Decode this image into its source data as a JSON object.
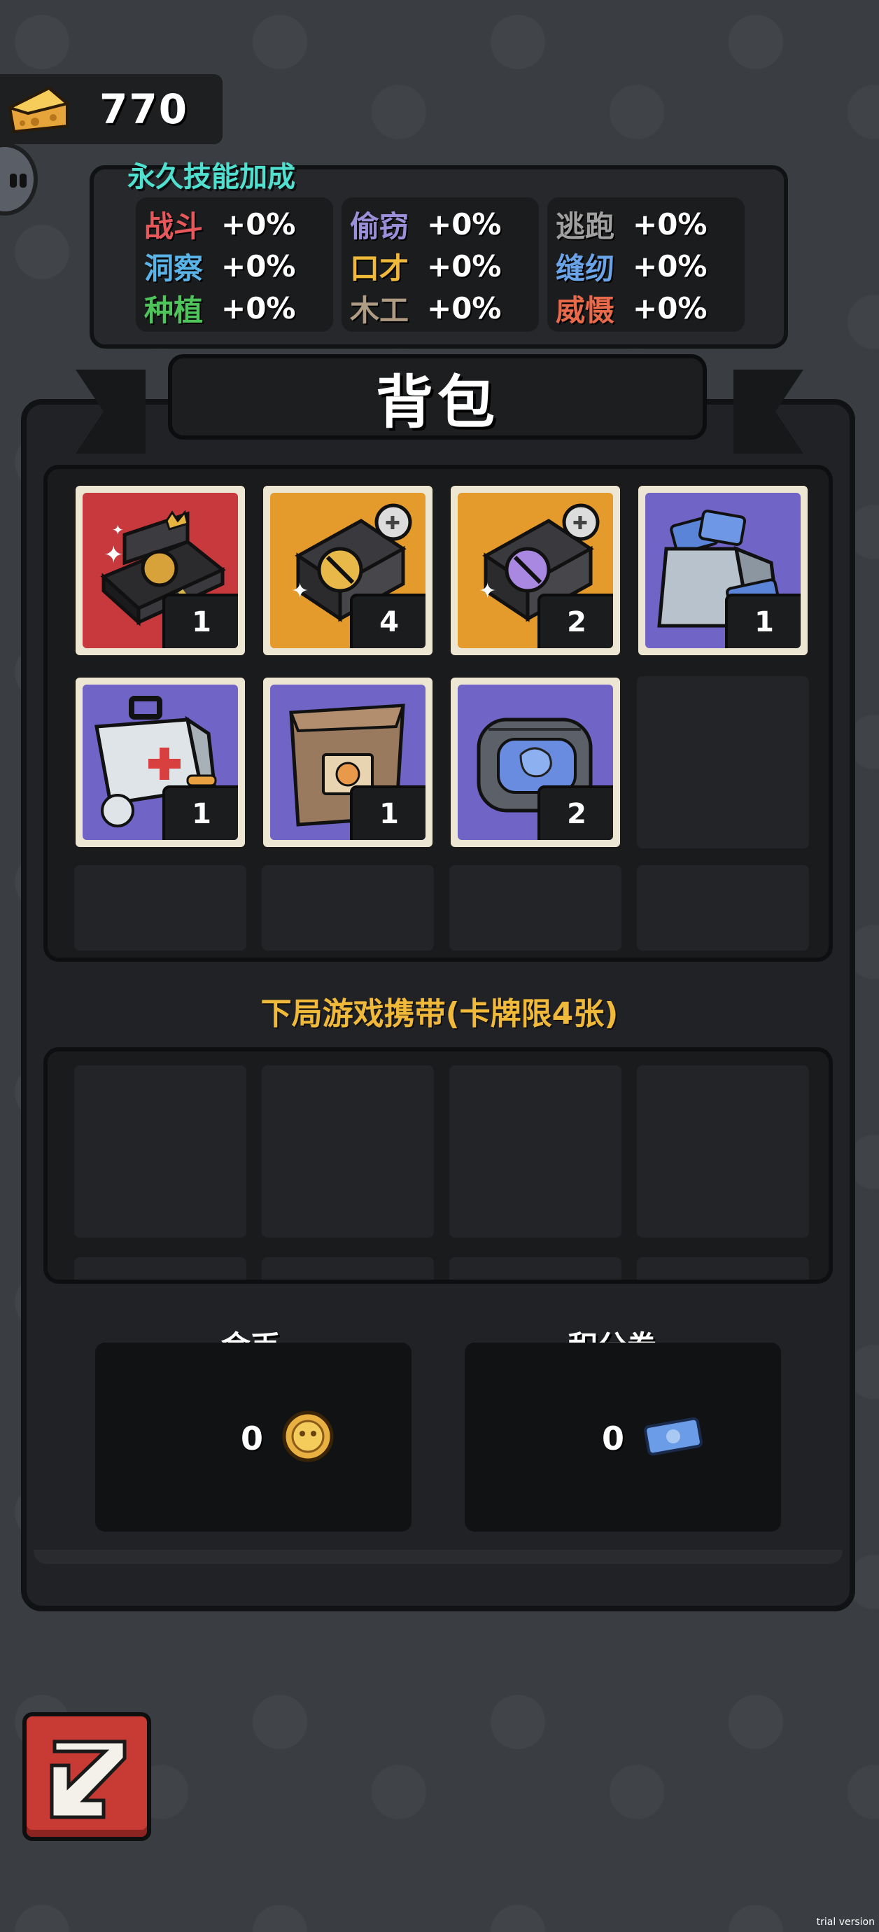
{
  "cheese": {
    "value": "770",
    "icon": "cheese-icon"
  },
  "skills": {
    "title": "永久技能加成",
    "groups": [
      [
        {
          "name": "战斗",
          "value": "+0%",
          "color": "#e8585a"
        },
        {
          "name": "洞察",
          "value": "+0%",
          "color": "#5ab4e8"
        },
        {
          "name": "种植",
          "value": "+0%",
          "color": "#4ec45a"
        }
      ],
      [
        {
          "name": "偷窃",
          "value": "+0%",
          "color": "#9a8fd8"
        },
        {
          "name": "口才",
          "value": "+0%",
          "color": "#f0b93a"
        },
        {
          "name": "木工",
          "value": "+0%",
          "color": "#b09c84"
        }
      ],
      [
        {
          "name": "逃跑",
          "value": "+0%",
          "color": "#a0a0a0"
        },
        {
          "name": "缝纫",
          "value": "+0%",
          "color": "#6aa4e8"
        },
        {
          "name": "威慑",
          "value": "+0%",
          "color": "#e86a4a"
        }
      ]
    ]
  },
  "backpack": {
    "title": "背包",
    "items": [
      {
        "icon": "gift-box-icon",
        "count": "1",
        "bg": "#c8393e"
      },
      {
        "icon": "golden-chest-icon",
        "count": "4",
        "bg": "#e59a2c"
      },
      {
        "icon": "purple-chest-icon",
        "count": "2",
        "bg": "#e59a2c"
      },
      {
        "icon": "ticket-bag-icon",
        "count": "1",
        "bg": "#7065c6"
      },
      {
        "icon": "first-aid-kit-icon",
        "count": "1",
        "bg": "#7065c6"
      },
      {
        "icon": "cloth-sack-icon",
        "count": "1",
        "bg": "#7065c6"
      },
      {
        "icon": "pouch-icon",
        "count": "2",
        "bg": "#7065c6"
      }
    ]
  },
  "carry": {
    "label": "下局游戏携带(卡牌限4张)"
  },
  "currency": {
    "gold": {
      "label": "金币",
      "value": "0",
      "icon": "gold-coin-icon"
    },
    "points": {
      "label": "积分券",
      "value": "0",
      "icon": "point-ticket-icon"
    }
  },
  "back_button": {
    "icon": "back-arrow-icon"
  },
  "watermark": "trial version"
}
